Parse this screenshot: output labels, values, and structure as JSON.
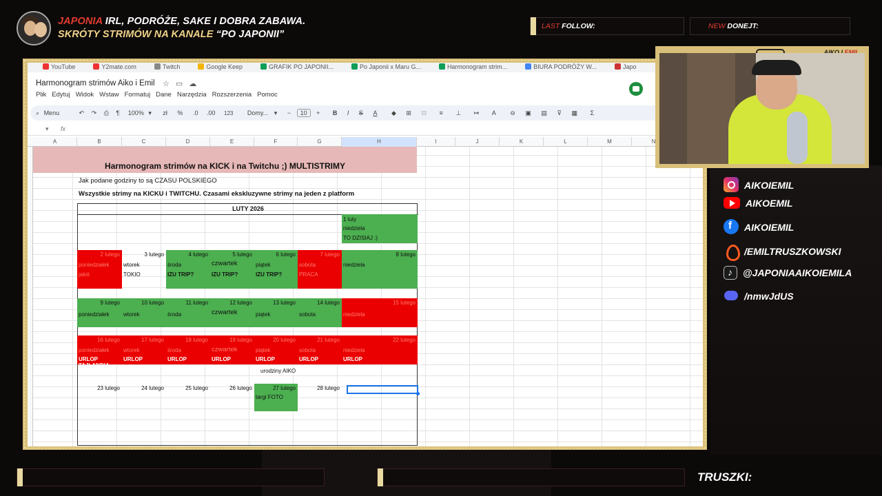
{
  "stream": {
    "tagline_line1_red": "JAPONIA",
    "tagline_line1_rest": " IRL, PODRÓŻE, SAKE I DOBRA ZABAWA.",
    "tagline_line2_part1": "SKRÓTY STRIMÓW NA KANALE ",
    "tagline_line2_part2": "“PO JAPONII”",
    "last_follow_red": "LAST",
    "last_follow_label": " FOLLOW:",
    "donation_red": "NEW",
    "donation_label": " DONEJT:",
    "cam_label_part1": "AIKO I ",
    "cam_label_part2": "EMIL",
    "truszki_label": "TRUSZKI:",
    "colors": {
      "accent_red": "#e23c2e",
      "frame_gold": "#d9c07a"
    }
  },
  "socials": [
    {
      "icon": "instagram-icon",
      "label": "AIKOIEMIL"
    },
    {
      "icon": "youtube-icon",
      "label": "AIKOEMIL"
    },
    {
      "icon": "facebook-icon",
      "label": "AIKOIEMIL"
    },
    {
      "icon": "kick-icon",
      "label": "/EMILTRUSZKOWSKI"
    },
    {
      "icon": "tiktok-icon",
      "label": "@JAPONIAAIKOIEMILA"
    },
    {
      "icon": "discord-icon",
      "label": "/nmwJdUS"
    }
  ],
  "browser": {
    "bookmarks": [
      "YouTube",
      "Y2mate.com",
      "Twitch",
      "Google Keep",
      "GRAFIK PO JAPONII...",
      "Po Japonii x Maru G...",
      "Harmonogram strim...",
      "BIURA PODRÓŻY W...",
      "Japo"
    ]
  },
  "sheets": {
    "doc_title": "Harmonogram strimów Aiko i Emil",
    "menus": [
      "Plik",
      "Edytuj",
      "Widok",
      "Wstaw",
      "Formatuj",
      "Dane",
      "Narzędzia",
      "Rozszerzenia",
      "Pomoc"
    ],
    "toolbar": {
      "menu_label": "Menu",
      "zoom": "100%",
      "currency": "zł",
      "percent": "%",
      "dec_less": ".0",
      "dec_more": ".00",
      "numfmt": "123",
      "font": "Domy...",
      "font_size": "10"
    },
    "columns": [
      "A",
      "B",
      "C",
      "D",
      "E",
      "F",
      "G",
      "H",
      "I",
      "J",
      "K",
      "L",
      "M",
      "N"
    ],
    "title": "Harmonogram strimów na KICK  i  na Twitchu ;) MULTISTRIMY",
    "note1": "Jak podane godziny to są CZASU POLSKIEGO",
    "note2": "Wszystkie strimy na KICKU i TWITCHU. Czasami ekskluzywne strimy na jeden z platform",
    "month": "LUTY 2026",
    "week0": {
      "date": "1 luty",
      "day": "niedziela",
      "note": "TO DZISIAJ :)"
    },
    "week1": [
      {
        "date": "2 lutego",
        "day": "poniedziałek",
        "note": "jakiś"
      },
      {
        "date": "3 lutego",
        "day": "wtorek",
        "note": "TOKIO"
      },
      {
        "date": "4 lutego",
        "day": "środa",
        "note": "IZU TRIP?"
      },
      {
        "date": "5 lutego",
        "day": "czwartek",
        "note": "IZU TRIP?"
      },
      {
        "date": "6 lutego",
        "day": "piątek",
        "note": "IZU TRIP?"
      },
      {
        "date": "7 lutego",
        "day": "sobota",
        "note": "PRACA"
      },
      {
        "date": "8 lutego",
        "day": "niedziela",
        "note": ""
      }
    ],
    "week2": [
      {
        "date": "9 lutego",
        "day": "poniedziałek"
      },
      {
        "date": "10 lutego",
        "day": "wtorek"
      },
      {
        "date": "11 lutego",
        "day": "środa"
      },
      {
        "date": "12 lutego",
        "day": "czwartek"
      },
      {
        "date": "13 lutego",
        "day": "piątek"
      },
      {
        "date": "14 lutego",
        "day": "sobota"
      },
      {
        "date": "15 lutego",
        "day": "niedziela"
      }
    ],
    "week3": [
      {
        "date": "16 lutego",
        "day": "poniedziałek",
        "note": "URLOP TAJLANDIA"
      },
      {
        "date": "17 lutego",
        "day": "wtorek",
        "note": "URLOP"
      },
      {
        "date": "18 lutego",
        "day": "środa",
        "note": "URLOP"
      },
      {
        "date": "19 lutego",
        "day": "czwartek",
        "note": "URLOP"
      },
      {
        "date": "20 lutego",
        "day": "piątek",
        "note": "URLOP"
      },
      {
        "date": "21 lutego",
        "day": "sobota",
        "note": "URLOP"
      },
      {
        "date": "22 lutego",
        "day": "niedziela",
        "note": "URLOP"
      }
    ],
    "birthday_note": "urodziny AIKO",
    "week4": [
      {
        "date": "23 lutego"
      },
      {
        "date": "24 lutego"
      },
      {
        "date": "25 lutego"
      },
      {
        "date": "26 lutego"
      },
      {
        "date": "27 lutego",
        "note": "targi FOTO"
      },
      {
        "date": "28 lutego"
      }
    ]
  }
}
